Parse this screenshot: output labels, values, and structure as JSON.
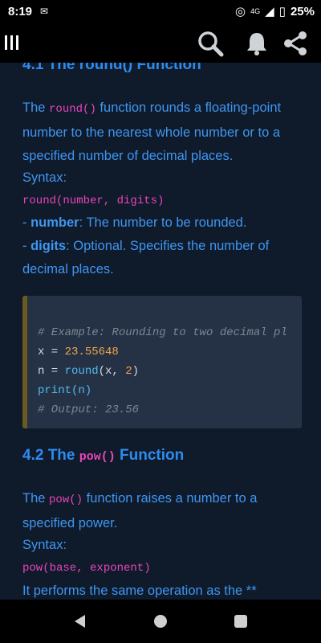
{
  "status": {
    "time": "8:19",
    "network": "4G",
    "battery": "25%"
  },
  "article": {
    "cut_heading": "4.1 The round() Function",
    "round_para": {
      "pre": "The ",
      "code": "round()",
      "post": " function rounds a floating-point number to the nearest whole number or to a specified number of decimal places."
    },
    "syntax_label": "Syntax:",
    "round_syntax": "round(number, digits)",
    "param1": {
      "dash": "- ",
      "name": "number",
      "desc": ": The number to be rounded."
    },
    "param2": {
      "dash": "- ",
      "name": "digits",
      "desc": ": Optional. Specifies the number of decimal places."
    },
    "code_lines": [
      "# Example: Rounding to two decimal pl",
      "x = 23.55648",
      "n = round(x, 2)",
      "print(n)",
      "# Output: 23.56"
    ],
    "pow_heading": {
      "pre": "4.2 The ",
      "code": "pow()",
      "post": " Function"
    },
    "pow_para": {
      "pre": "The ",
      "code": "pow()",
      "post": " function raises a number to a specified power."
    },
    "pow_syntax": "pow(base, exponent)",
    "pow_tail": "It performs the same operation as the **"
  },
  "icons": {
    "menu": "hamburger-icon",
    "search": "search-icon",
    "bell": "bell-icon",
    "share": "share-icon"
  }
}
